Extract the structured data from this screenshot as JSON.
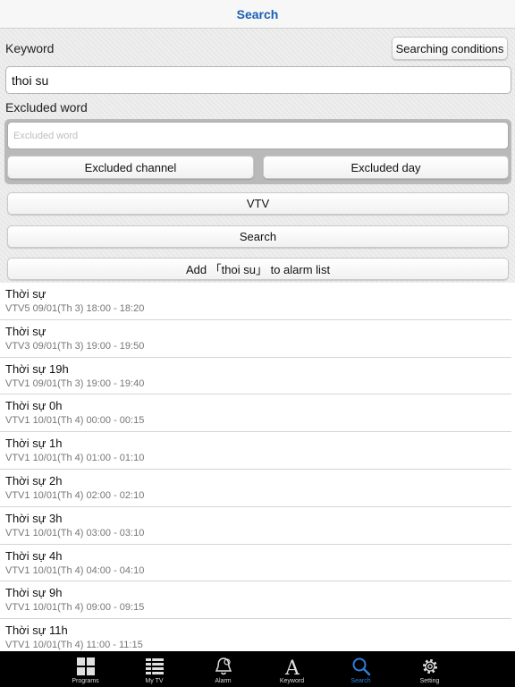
{
  "header": {
    "title": "Search"
  },
  "form": {
    "keyword_label": "Keyword",
    "conditions_button": "Searching conditions",
    "keyword_value": "thoi su",
    "excluded_label": "Excluded word",
    "excluded_placeholder": "Excluded word",
    "excluded_channel_button": "Excluded channel",
    "excluded_day_button": "Excluded day",
    "channel_button": "VTV",
    "search_button": "Search",
    "alarm_button": "Add 「thoi su」 to alarm list"
  },
  "results": [
    {
      "title": "Thời sự",
      "detail": "VTV5 09/01(Th 3) 18:00 - 18:20"
    },
    {
      "title": "Thời sự",
      "detail": "VTV3 09/01(Th 3) 19:00 - 19:50"
    },
    {
      "title": "Thời sự 19h",
      "detail": "VTV1 09/01(Th 3) 19:00 - 19:40"
    },
    {
      "title": "Thời sự 0h",
      "detail": "VTV1 10/01(Th 4) 00:00 - 00:15"
    },
    {
      "title": "Thời sự 1h",
      "detail": "VTV1 10/01(Th 4) 01:00 - 01:10"
    },
    {
      "title": "Thời sự 2h",
      "detail": "VTV1 10/01(Th 4) 02:00 - 02:10"
    },
    {
      "title": "Thời sự 3h",
      "detail": "VTV1 10/01(Th 4) 03:00 - 03:10"
    },
    {
      "title": "Thời sự 4h",
      "detail": "VTV1 10/01(Th 4) 04:00 - 04:10"
    },
    {
      "title": "Thời sự 9h",
      "detail": "VTV1 10/01(Th 4) 09:00 - 09:15"
    },
    {
      "title": "Thời sự 11h",
      "detail": "VTV1 10/01(Th 4) 11:00 - 11:15"
    }
  ],
  "tabs": [
    {
      "label": "Programs",
      "icon": "grid-icon"
    },
    {
      "label": "My TV",
      "icon": "list-icon"
    },
    {
      "label": "Alarm",
      "icon": "bell-icon"
    },
    {
      "label": "Keyword",
      "icon": "letter-a-icon"
    },
    {
      "label": "Search",
      "icon": "magnifier-icon",
      "active": true
    },
    {
      "label": "Setting",
      "icon": "gear-icon"
    }
  ],
  "colors": {
    "accent": "#2f7dd8",
    "title": "#1a5fb4",
    "tab_bar": "#000000"
  }
}
